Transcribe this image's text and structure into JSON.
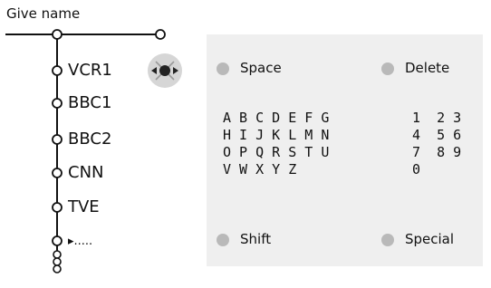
{
  "tree": {
    "title": "Give name",
    "items": [
      "VCR1",
      "BBC1",
      "BBC2",
      "CNN",
      "TVE",
      "▸....."
    ]
  },
  "navigator": {
    "icon": "cursor-keys-icon"
  },
  "panel": {
    "top_left": "Space",
    "top_right": "Delete",
    "bottom_left": "Shift",
    "bottom_right": "Special",
    "letters": [
      "A B C D E F G",
      "H I J K L M N",
      "O P Q R S T U",
      "V W X Y Z"
    ],
    "numbers": [
      "1  2 3",
      "4  5 6",
      "7  8 9",
      "0"
    ]
  },
  "colors": {
    "panel_bg": "#efefef",
    "key_dot": "#b9b9b9",
    "line": "#111111"
  }
}
